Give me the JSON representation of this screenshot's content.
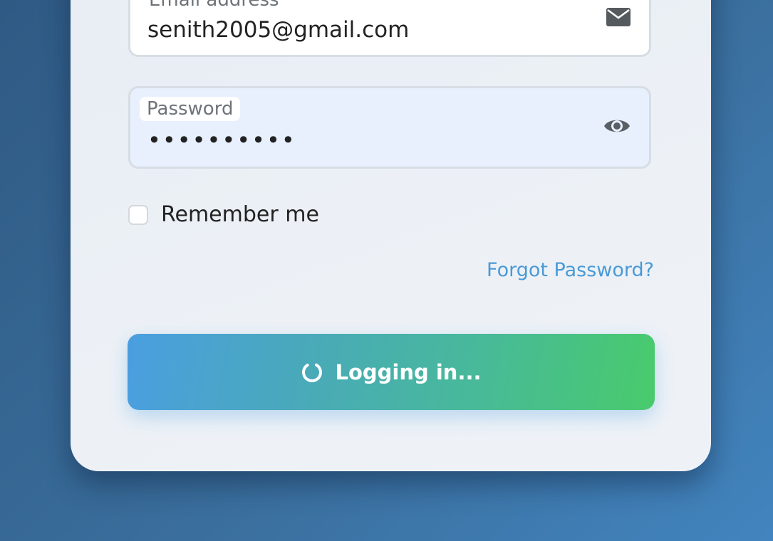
{
  "login_form": {
    "email": {
      "label": "Email address",
      "value": "senith2005@gmail.com",
      "icon": "envelope-icon"
    },
    "password": {
      "label": "Password",
      "value": "••••••••••",
      "icon": "eye-icon"
    },
    "remember_me": {
      "label": "Remember me",
      "checked": false
    },
    "forgot_password": "Forgot Password?",
    "submit": {
      "label": "Logging in...",
      "icon": "spinner-icon",
      "state": "loading"
    }
  },
  "colors": {
    "background": "#3a6e9c",
    "card": "#edf1f6",
    "link": "#4a9ad6",
    "button_gradient_start": "#4a9ee0",
    "button_gradient_end": "#49cb6c",
    "password_field_bg": "#e8f0fe"
  }
}
